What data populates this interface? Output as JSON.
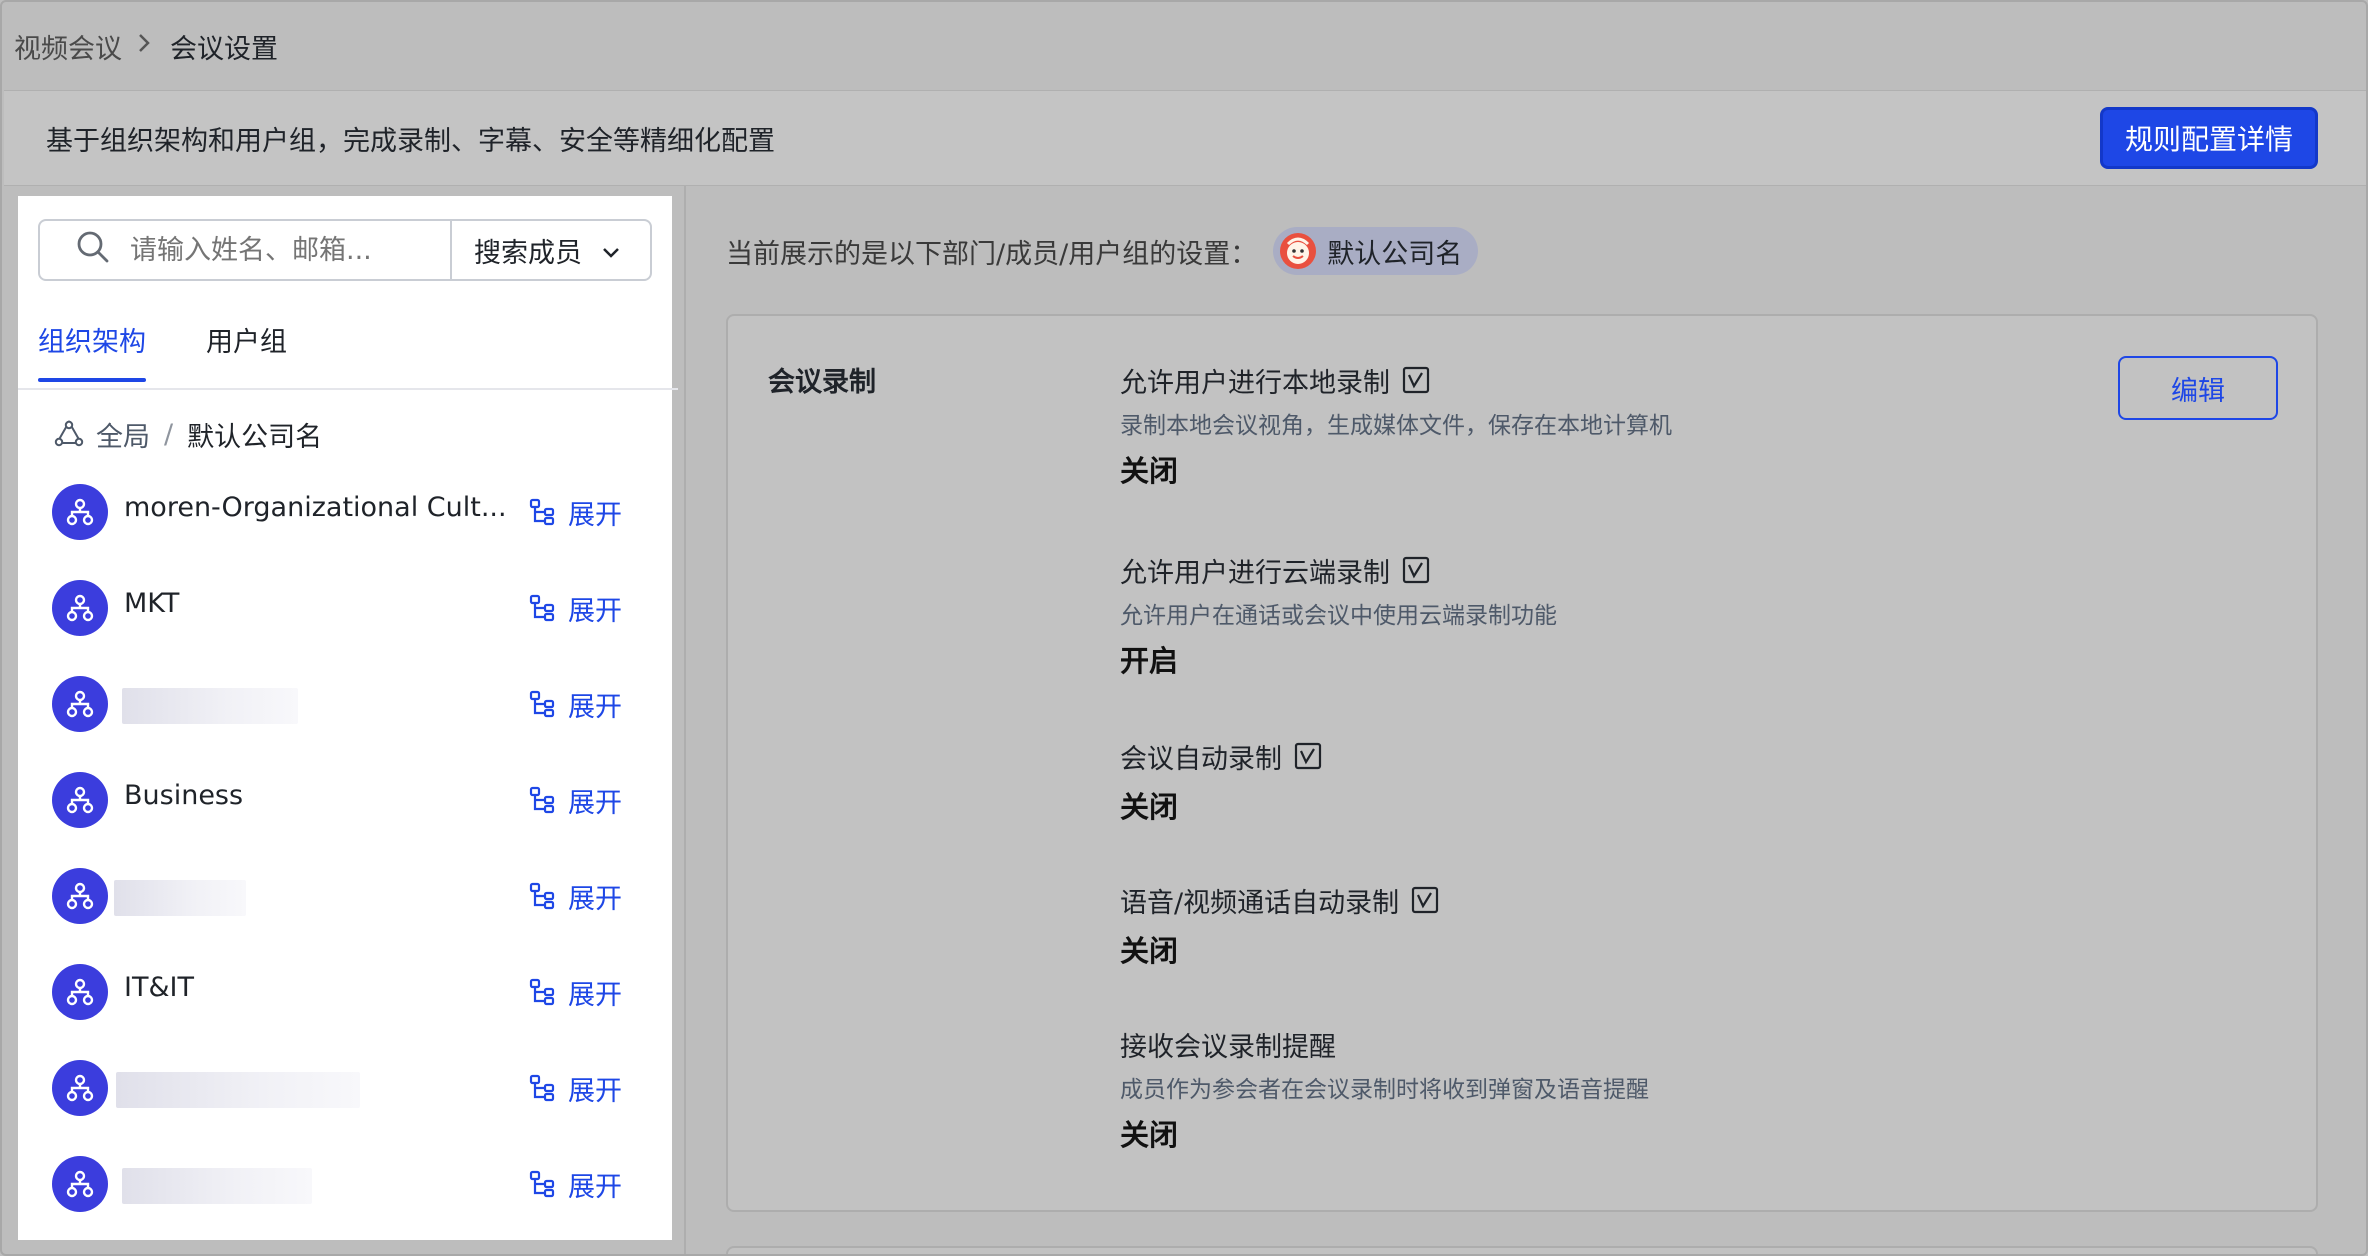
{
  "breadcrumb": {
    "parent": "视频会议",
    "current": "会议设置"
  },
  "banner": {
    "text": "基于组织架构和用户组，完成录制、字幕、安全等精细化配置",
    "button_label": "规则配置详情"
  },
  "search": {
    "placeholder": "请输入姓名、邮箱...",
    "type_label": "搜索成员"
  },
  "tabs": {
    "org": "组织架构",
    "group": "用户组",
    "active": "org"
  },
  "org_path": {
    "global": "全局",
    "separator": "/",
    "company": "默认公司名"
  },
  "org_items": [
    {
      "name": "moren-Organizational Cult...",
      "expand": "展开",
      "redacted": false
    },
    {
      "name": "MKT",
      "expand": "展开",
      "redacted": false
    },
    {
      "name": "",
      "expand": "展开",
      "redacted": true
    },
    {
      "name": "Business",
      "expand": "展开",
      "redacted": false
    },
    {
      "name": "",
      "expand": "展开",
      "redacted": true
    },
    {
      "name": "IT&IT",
      "expand": "展开",
      "redacted": false
    },
    {
      "name": "",
      "expand": "展开",
      "redacted": true
    },
    {
      "name": "",
      "expand": "展开",
      "redacted": true
    }
  ],
  "current_setting": {
    "label": "当前展示的是以下部门/成员/用户组的设置：",
    "company": "默认公司名"
  },
  "card": {
    "title": "会议录制",
    "edit_label": "编辑",
    "settings": [
      {
        "title": "允许用户进行本地录制",
        "desc": "录制本地会议视角，生成媒体文件，保存在本地计算机",
        "value": "关闭"
      },
      {
        "title": "允许用户进行云端录制",
        "desc": "允许用户在通话或会议中使用云端录制功能",
        "value": "开启"
      },
      {
        "title": "会议自动录制",
        "desc": "",
        "value": "关闭"
      },
      {
        "title": "语音/视频通话自动录制",
        "desc": "",
        "value": "关闭"
      },
      {
        "title": "接收会议录制提醒",
        "desc": "成员作为参会者在会议录制时将收到弹窗及语音提醒",
        "value": "关闭"
      }
    ]
  },
  "colors": {
    "accent": "#1e47e6",
    "avatar": "#3b3ddd"
  }
}
